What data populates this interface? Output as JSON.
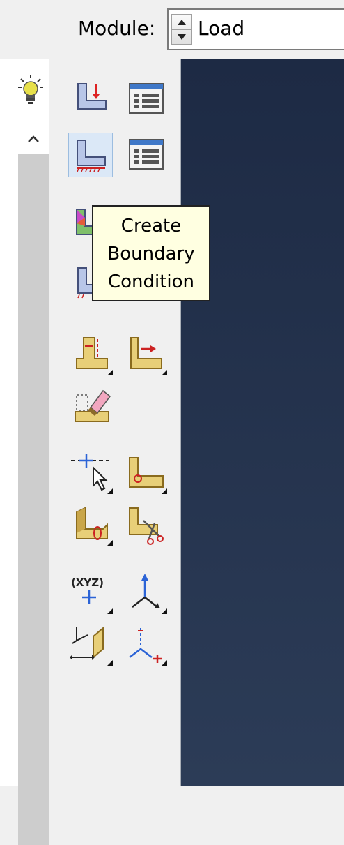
{
  "header": {
    "module_label": "Module:",
    "module_value": "Load"
  },
  "icons": {
    "hint": "lightbulb-icon",
    "scroll_up": "chevron-up-icon"
  },
  "toolbox": {
    "groups": [
      {
        "name": "load-bc-group",
        "tools": [
          "create-load-icon",
          "load-manager-icon",
          "create-bc-icon",
          "bc-manager-icon",
          "create-predefined-field-icon",
          "create-interaction-icon"
        ]
      },
      {
        "name": "partition-group",
        "tools": [
          "partition-edge-icon",
          "partition-face-icon",
          "erase-icon"
        ]
      },
      {
        "name": "query-group",
        "tools": [
          "datum-point-icon",
          "datum-axis-icon",
          "datum-plane-icon",
          "cut-icon"
        ]
      },
      {
        "name": "csys-group",
        "tools": [
          "xyz-point-icon",
          "datum-csys-icon",
          "create-datum-plane-icon",
          "create-datum-csys-icon"
        ]
      }
    ]
  },
  "tooltip": {
    "line1": "Create",
    "line2": "Boundary",
    "line3": "Condition"
  },
  "colors": {
    "viewport_top": "#1d2a44",
    "viewport_bottom": "#2c3c57",
    "tooltip_bg": "#ffffe1",
    "active_tool_bg": "#dbe8f7"
  }
}
